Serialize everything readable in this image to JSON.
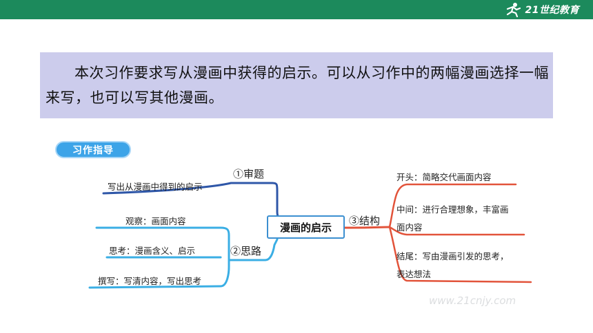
{
  "header": {
    "logo_text": "21世纪教育",
    "logo_sub": "WWW.21CNJY.COM"
  },
  "intro": {
    "text": "本次习作要求写从漫画中获得的启示。可以从习作中的两幅漫画选择一幅来写，也可以写其他漫画。"
  },
  "guide": {
    "title": "习作指导"
  },
  "mindmap": {
    "center": "漫画的启示",
    "branches": {
      "review": {
        "label": "①审题",
        "items": [
          "写出从漫画中得到的启示"
        ]
      },
      "thinking": {
        "label": "②思路",
        "items": [
          "观察：画面内容",
          "思考：漫画含义、启示",
          "撰写：写清内容，写出思考"
        ]
      },
      "structure": {
        "label": "③结构",
        "items": [
          "开头：简略交代画面内容",
          "中间：进行合理想象，丰富画面内容",
          "结尾：写由漫画引发的思考，表达想法"
        ],
        "middle_line1": "中间：进行合理想象，丰富画",
        "middle_line2": "面内容",
        "end_line1": "结尾：写由漫画引发的思考，",
        "end_line2": "表达想法"
      }
    },
    "watermark": "www.21cnjy.com"
  },
  "colors": {
    "topbar": "#1c8a5c",
    "textbox": "#ccccec",
    "review_branch": "#2f57a8",
    "thinking_branch": "#3aaee4",
    "structure_branch": "#e2533a",
    "guide_tag": "#3da4e8"
  }
}
